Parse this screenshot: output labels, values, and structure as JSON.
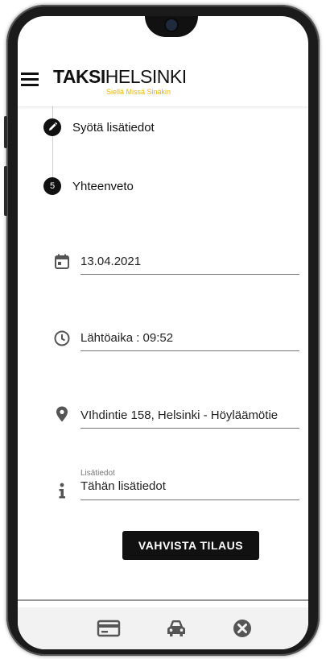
{
  "header": {
    "logo_bold": "TAKSI",
    "logo_light": "HELSINKI",
    "logo_tagline": "Siellä Missä Sinäkin"
  },
  "steps": [
    {
      "number": "",
      "label": "Syötä lisätiedot",
      "icon": "pencil-icon"
    },
    {
      "number": "5",
      "label": "Yhteenveto"
    }
  ],
  "summary": {
    "date": "13.04.2021",
    "departure_time": "Lähtöaika : 09:52",
    "address": "VIhdintie 158, Helsinki - Höyläämötie",
    "info_label": "Lisätiedot",
    "info_value": "Tähän lisätiedot"
  },
  "confirm_button": "VAHVISTA TILAUS",
  "bottom_nav": [
    {
      "icon": "payment-card-icon"
    },
    {
      "icon": "taxi-car-icon"
    },
    {
      "icon": "cancel-circle-icon"
    }
  ],
  "colors": {
    "brand_yellow": "#e6b800",
    "primary": "#111111",
    "nav_bg": "#f2f2f2"
  }
}
